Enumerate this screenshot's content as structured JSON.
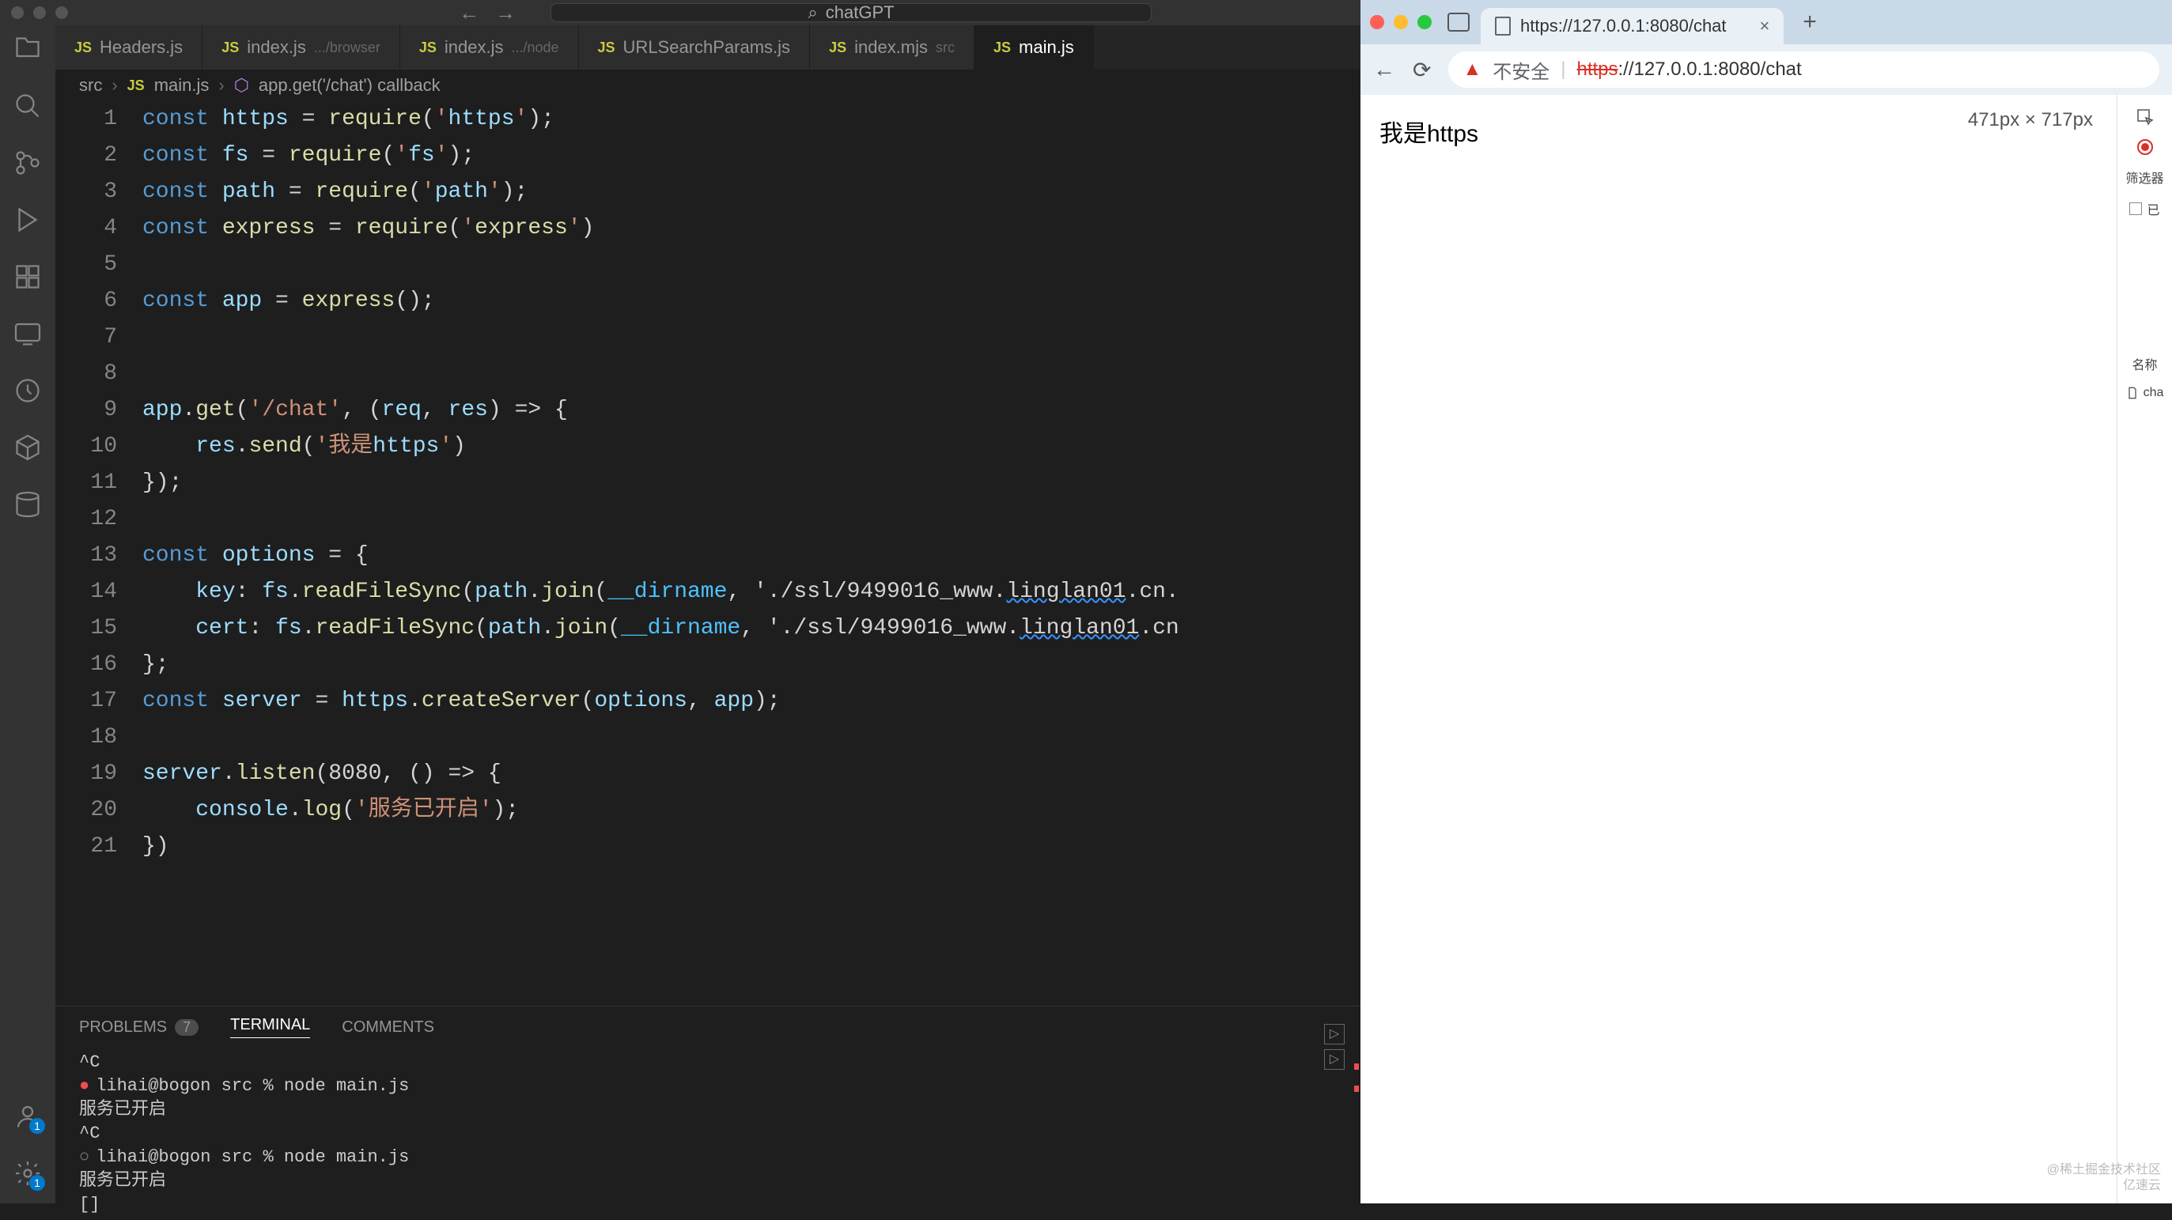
{
  "vscode": {
    "search_placeholder": "chatGPT",
    "tabs": [
      {
        "name": "Headers.js",
        "path": ""
      },
      {
        "name": "index.js",
        "path": ".../browser"
      },
      {
        "name": "index.js",
        "path": ".../node"
      },
      {
        "name": "URLSearchParams.js",
        "path": ""
      },
      {
        "name": "index.mjs",
        "path": "src"
      },
      {
        "name": "main.js",
        "path": "",
        "active": true
      }
    ],
    "breadcrumb": {
      "root": "src",
      "file": "main.js",
      "symbol": "app.get('/chat') callback"
    },
    "code_lines": [
      "const https = require('https');",
      "const fs = require('fs');",
      "const path = require('path');",
      "const express = require('express')",
      "",
      "const app = express();",
      "",
      "",
      "app.get('/chat', (req, res) => {",
      "    res.send('我是https')",
      "});",
      "",
      "const options = {",
      "    key: fs.readFileSync(path.join(__dirname, './ssl/9499016_www.linglan01.cn.",
      "    cert: fs.readFileSync(path.join(__dirname, './ssl/9499016_www.linglan01.cn",
      "};",
      "const server = https.createServer(options, app);",
      "",
      "server.listen(8080, () => {",
      "    console.log('服务已开启');",
      "})"
    ],
    "panel": {
      "tabs": {
        "problems": "PROBLEMS",
        "problems_count": "7",
        "terminal": "TERMINAL",
        "comments": "COMMENTS"
      },
      "terminal_lines": [
        "^C",
        "lihai@bogon src % node main.js",
        "服务已开启",
        "^C",
        "lihai@bogon src % node main.js",
        "服务已开启",
        "[]"
      ]
    },
    "activity_badges": {
      "account": "1",
      "settings": "1"
    }
  },
  "browser": {
    "tab_title": "https://127.0.0.1:8080/chat",
    "insecure_label": "不安全",
    "url_scheme": "https",
    "url_rest": "://127.0.0.1:8080/chat",
    "page_text": "我是https",
    "viewport_label": "471px × 717px",
    "devtools": {
      "inspect": "",
      "filter_label": "筛选器",
      "already": "已",
      "name_col": "名称",
      "row1": "cha"
    }
  },
  "watermark": {
    "l1": "@稀土掘金技术社区",
    "l2": "亿速云"
  }
}
